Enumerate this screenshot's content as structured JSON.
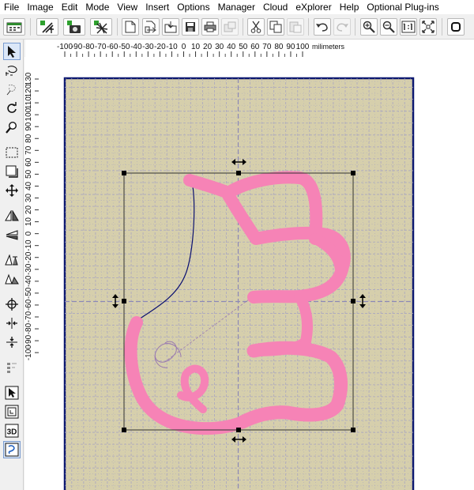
{
  "menu": [
    "File",
    "Image",
    "Edit",
    "Mode",
    "View",
    "Insert",
    "Options",
    "Manager",
    "Cloud",
    "eXplorer",
    "Help",
    "Optional Plug-ins"
  ],
  "ruler": {
    "h_labels": [
      "-100",
      "-90",
      "-80",
      "-70",
      "-60",
      "-50",
      "-40",
      "-30",
      "-20",
      "-10",
      "0",
      "10",
      "20",
      "30",
      "40",
      "50",
      "60",
      "70",
      "80",
      "90",
      "100"
    ],
    "unit": "milimeters",
    "v_labels": [
      "130",
      "120",
      "110",
      "100",
      "90",
      "80",
      "70",
      "60",
      "50",
      "40",
      "30",
      "20",
      "10",
      "0",
      "-10",
      "-20",
      "-30",
      "-40",
      "-50",
      "-60",
      "-70",
      "-80",
      "-90",
      "-100"
    ]
  },
  "toolbox": {
    "text_3d": "3D"
  },
  "toolbar_icons": [
    "file-icon",
    "select-all-icon",
    "image-icon",
    "hide-icon",
    "new-icon",
    "open-icon",
    "import-icon",
    "save-icon",
    "print-icon",
    "export-icon",
    "cut-icon",
    "copy-icon",
    "paste-icon",
    "undo-icon",
    "redo-icon",
    "zoom-in-icon",
    "zoom-out-icon",
    "zoom-1to1-icon",
    "zoom-fit-icon",
    "stop-icon"
  ],
  "colors": {
    "canvas": "#d6cfac",
    "grid": "#9a9ab8",
    "hoop_border": "#0c1870",
    "embroidery": "#f683b6",
    "outline": "#0a1070",
    "stitch_preview": "#9a7ab0",
    "bbox": "#303030"
  }
}
